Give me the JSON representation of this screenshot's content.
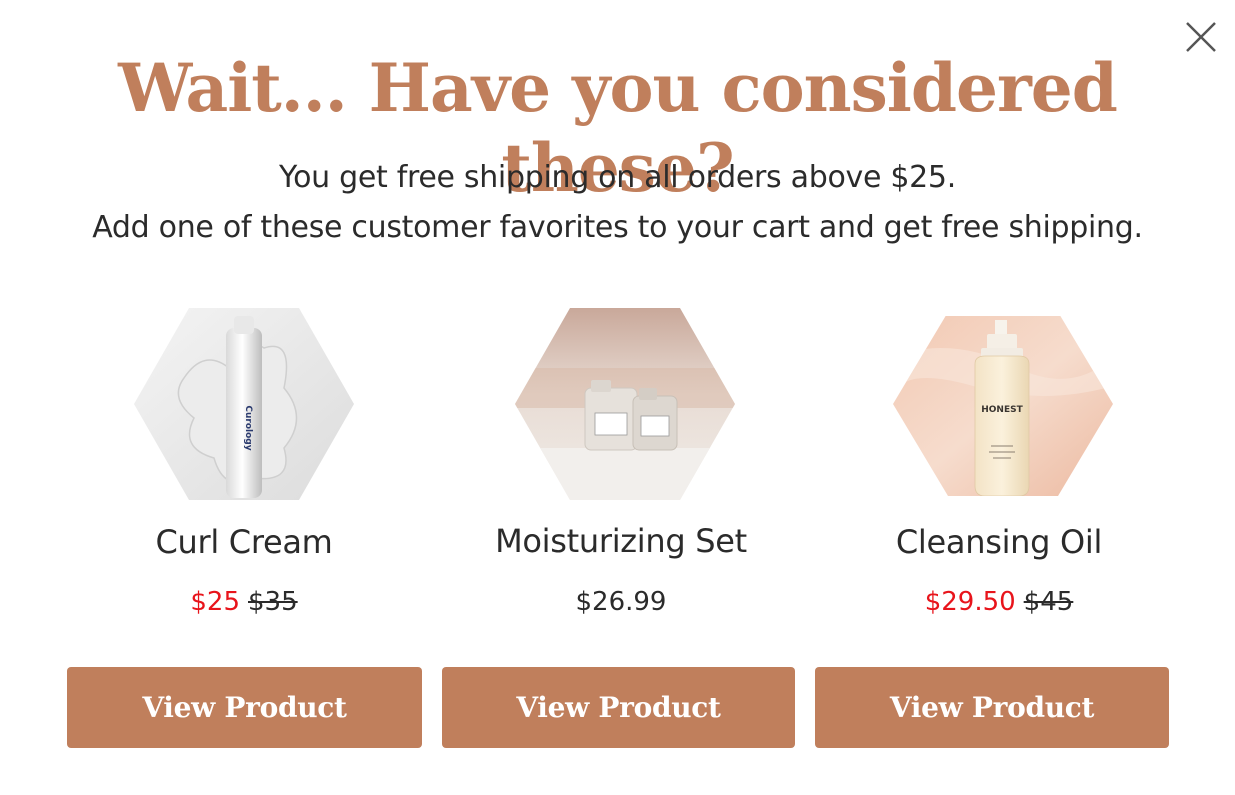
{
  "popup": {
    "title": "Wait... Have you considered these?",
    "subtitle_line1": "You get free shipping on all orders above $25.",
    "subtitle_line2": "Add one of these customer favorites to your cart and get free shipping.",
    "close_icon": "close-icon"
  },
  "products": [
    {
      "name": "Curl Cream",
      "sale_price": "$25",
      "old_price": "$35",
      "button": "View Product",
      "image_brand_text": "Curology"
    },
    {
      "name": "Moisturizing Set",
      "price": "$26.99",
      "button": "View Product"
    },
    {
      "name": "Cleansing Oil",
      "sale_price": "$29.50",
      "old_price": "$45",
      "button": "View Product",
      "image_brand_text": "HONEST"
    }
  ],
  "colors": {
    "accent": "#c07f5c",
    "sale": "#e8141b",
    "text": "#2b2b2b"
  }
}
